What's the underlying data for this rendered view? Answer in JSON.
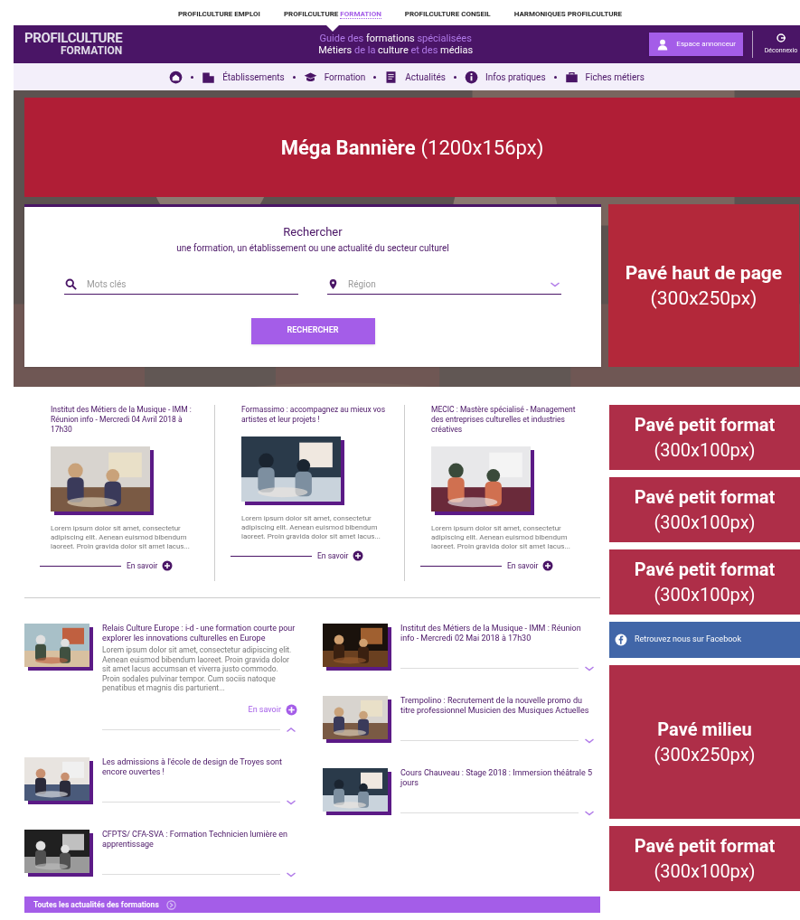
{
  "top_links": [
    {
      "text": "PROFILCULTURE EMPLOI",
      "selected": false
    },
    {
      "text": "PROFILCULTURE ",
      "accent": "FORMATION",
      "selected": true
    },
    {
      "text": "PROFILCULTURE CONSEIL",
      "selected": false
    },
    {
      "text": "HARMONIQUES PROFILCULTURE",
      "selected": false
    }
  ],
  "header": {
    "logo_top": "PROFILCULTURE",
    "logo_bottom": "FORMATION",
    "tagline": [
      [
        {
          "t": "Guide des ",
          "accent": true
        },
        {
          "t": "formations ",
          "accent": false
        },
        {
          "t": "spécialisées",
          "accent": true
        }
      ],
      [
        {
          "t": "Métiers ",
          "accent": false
        },
        {
          "t": "de la ",
          "accent": true
        },
        {
          "t": "culture ",
          "accent": false
        },
        {
          "t": "et des ",
          "accent": true
        },
        {
          "t": "médias",
          "accent": false
        }
      ]
    ],
    "advertiser_button": "Espace annonceur",
    "logout": "Déconnexio"
  },
  "nav": [
    {
      "kind": "home"
    },
    {
      "kind": "building",
      "label": "Établissements"
    },
    {
      "kind": "cap",
      "label": "Formation"
    },
    {
      "kind": "doc",
      "label": "Actualités"
    },
    {
      "kind": "info",
      "label": "Infos pratiques"
    },
    {
      "kind": "case",
      "label": "Fiches métiers"
    }
  ],
  "banner": {
    "title": "Méga Bannière",
    "size": "(1200x156px)"
  },
  "search": {
    "title": "Rechercher",
    "subtitle": "une formation, un établissement ou une actualité du secteur culturel",
    "keywords_placeholder": "Mots clés",
    "region_placeholder": "Région",
    "button": "RECHERCHER"
  },
  "top_ad": {
    "title": "Pavé haut de page",
    "size": "(300x250px)"
  },
  "featured": [
    {
      "title": "Institut des Métiers de la Musique - IMM : Réunion info - Mercredi 04 Avril 2018 à 17h30",
      "excerpt": "Lorem ipsum dolor sit amet, consectetur adipiscing elit. Aenean euismod bibendum laoreet. Proin gravida dolor sit amet lacus...",
      "link": "En savoir"
    },
    {
      "title": "Formassimo : accompagnez au mieux vos artistes et leur projets !",
      "excerpt": "Lorem ipsum dolor sit amet, consectetur adipiscing elit. Aenean euismod bibendum laoreet. Proin gravida dolor sit amet lacus...",
      "link": "En savoir"
    },
    {
      "title": "MECIC : Mastère spécialisé - Management des entreprises culturelles et industries créatives",
      "excerpt": "Lorem ipsum dolor sit amet, consectetur adipiscing elit. Aenean euismod bibendum laoreet. Proin gravida dolor sit amet lacus...",
      "link": "En savoir"
    }
  ],
  "news_columns": [
    [
      {
        "title": "Relais Culture Europe : i-d - une formation courte pour explorer les innovations culturelles en Europe",
        "expanded": true,
        "excerpt": "Lorem ipsum dolor sit amet, consectetur adipiscing elit. Aenean euismod bibendum laoreet. Proin gravida dolor sit amet lacus accumsan et viverra justo commodo. Proin sodales pulvinar tempor. Cum sociis natoque penatibus et magnis dis parturient...",
        "link": "En savoir"
      },
      {
        "title": "Les admissions à l'école de design de Troyes sont encore ouvertes !",
        "expanded": false
      },
      {
        "title": "CFPTS/ CFA-SVA : Formation Technicien lumière en apprentissage",
        "expanded": false
      }
    ],
    [
      {
        "title": "Institut des Métiers de la Musique - IMM : Réunion info - Mercredi 02 Mai 2018 à 17h30",
        "expanded": false
      },
      {
        "title": "Trempolino : Recrutement de la nouvelle promo du titre professionnel Musicien des Musiques Actuelles",
        "expanded": false
      },
      {
        "title": "Cours Chauveau : Stage 2018 : Immersion théâtrale 5 jours",
        "expanded": false
      }
    ]
  ],
  "all_news_bar": "Toutes les actualités des formations",
  "sidebar": [
    {
      "kind": "ad",
      "title": "Pavé petit format",
      "size": "(300x100px)"
    },
    {
      "kind": "ad",
      "title": "Pavé petit format",
      "size": "(300x100px)"
    },
    {
      "kind": "ad",
      "title": "Pavé petit format",
      "size": "(300x100px)"
    },
    {
      "kind": "facebook",
      "text": "Retrouvez nous sur Facebook"
    },
    {
      "kind": "ad_large",
      "title": "Pavé milieu",
      "size": "(300x250px)"
    },
    {
      "kind": "ad",
      "title": "Pavé petit format",
      "size": "(300x100px)"
    }
  ]
}
